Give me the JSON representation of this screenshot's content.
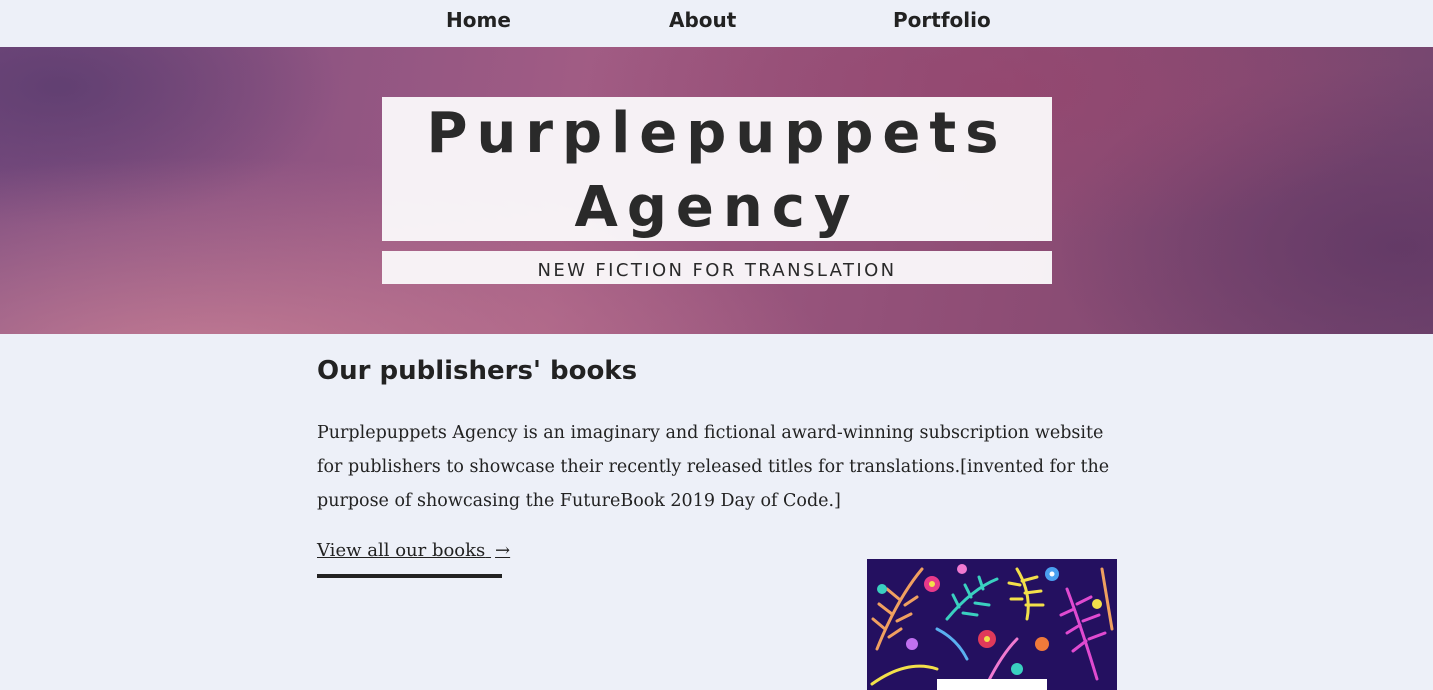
{
  "nav": {
    "home": "Home",
    "about": "About",
    "portfolio": "Portfolio"
  },
  "hero": {
    "title_line1": "Purplepuppets",
    "title_line2": "Agency",
    "subtitle": "NEW FICTION FOR TRANSLATION"
  },
  "main": {
    "heading": "Our publishers' books",
    "paragraph": "Purplepuppets Agency is an imaginary and fictional award-winning subscription website for publishers to showcase their recently released titles for translations.[invented for the purpose of showcasing the FutureBook 2019 Day of Code.]",
    "link_label": "View all our books",
    "link_arrow": "→"
  },
  "colors": {
    "background": "#edf0f8",
    "text": "#222222",
    "hero_purple": "#8e4d75",
    "cover_navy": "#241060"
  }
}
